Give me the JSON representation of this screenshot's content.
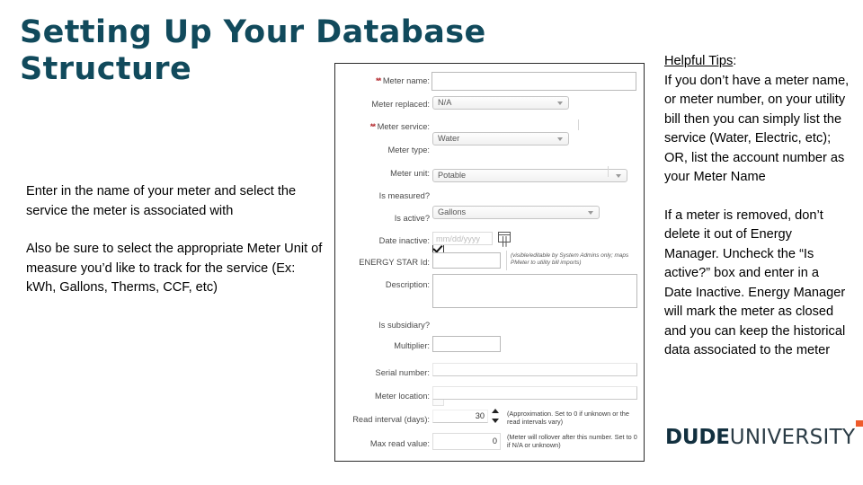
{
  "slide": {
    "title": "Setting Up Your Database Structure",
    "title_color": "#114a5c"
  },
  "left_copy": {
    "paragraph_1": "Enter in the name of your meter and select the service the meter is associated with",
    "paragraph_2": "Also be sure to select the appropriate Meter Unit of measure you’d like to track for the service (Ex: kWh, Gallons, Therms, CCF, etc)"
  },
  "tips": {
    "heading": "Helpful Tips",
    "heading_colon": ":",
    "paragraph_1": "If you don’t have a meter name, or meter number, on your utility bill then you can simply list the service (Water, Electric, etc); OR, list the account number as your Meter Name",
    "paragraph_2": "If a meter is removed, don’t delete it out of Energy Manager. Uncheck the “Is active?” box and enter in a Date Inactive. Energy Manager will mark the meter as closed and you can keep the historical data associated to the meter"
  },
  "logo": {
    "word_bold": "DUDE",
    "word_regular": "UNIVERSITY",
    "accent_color": "#ef5b2b",
    "text_color": "#12303f",
    "mark": "flag-icon"
  },
  "form": {
    "fields": {
      "meter_name": {
        "label": "Meter name:",
        "required_mark": "**",
        "value": ""
      },
      "meter_replaced": {
        "label": "Meter replaced:",
        "value": "N/A"
      },
      "meter_service": {
        "label": "Meter service:",
        "required_mark": "**",
        "value": "Water"
      },
      "meter_type": {
        "label": "Meter type:",
        "value": "Potable"
      },
      "meter_unit": {
        "label": "Meter unit:",
        "value": "Gallons"
      },
      "is_measured": {
        "label": "Is measured?",
        "checked": "✔"
      },
      "is_active": {
        "label": "Is active?",
        "checked": "✔"
      },
      "date_inactive": {
        "label": "Date inactive:",
        "placeholder": "mm/dd/yyyy",
        "icon": "calendar-icon"
      },
      "energy_star_id": {
        "label": "ENERGY STAR Id:",
        "value": "",
        "hint": "(visible/editable by System Admins only; maps PMeter to utility bill imports)"
      },
      "description": {
        "label": "Description:",
        "value": ""
      },
      "is_subsidiary": {
        "label": "Is subsidiary?",
        "checked": ""
      },
      "multiplier": {
        "label": "Multiplier:",
        "value": ""
      },
      "serial_number": {
        "label": "Serial number:",
        "value": ""
      },
      "meter_location": {
        "label": "Meter location:",
        "value": ""
      },
      "read_interval": {
        "label": "Read interval (days):",
        "value": "30",
        "hint": "(Approximation. Set to 0 if unknown or the read intervals vary)"
      },
      "max_read_value": {
        "label": "Max read value:",
        "value": "0",
        "hint": "(Meter will rollover after this number. Set to 0 if N/A or unknown)"
      }
    }
  }
}
